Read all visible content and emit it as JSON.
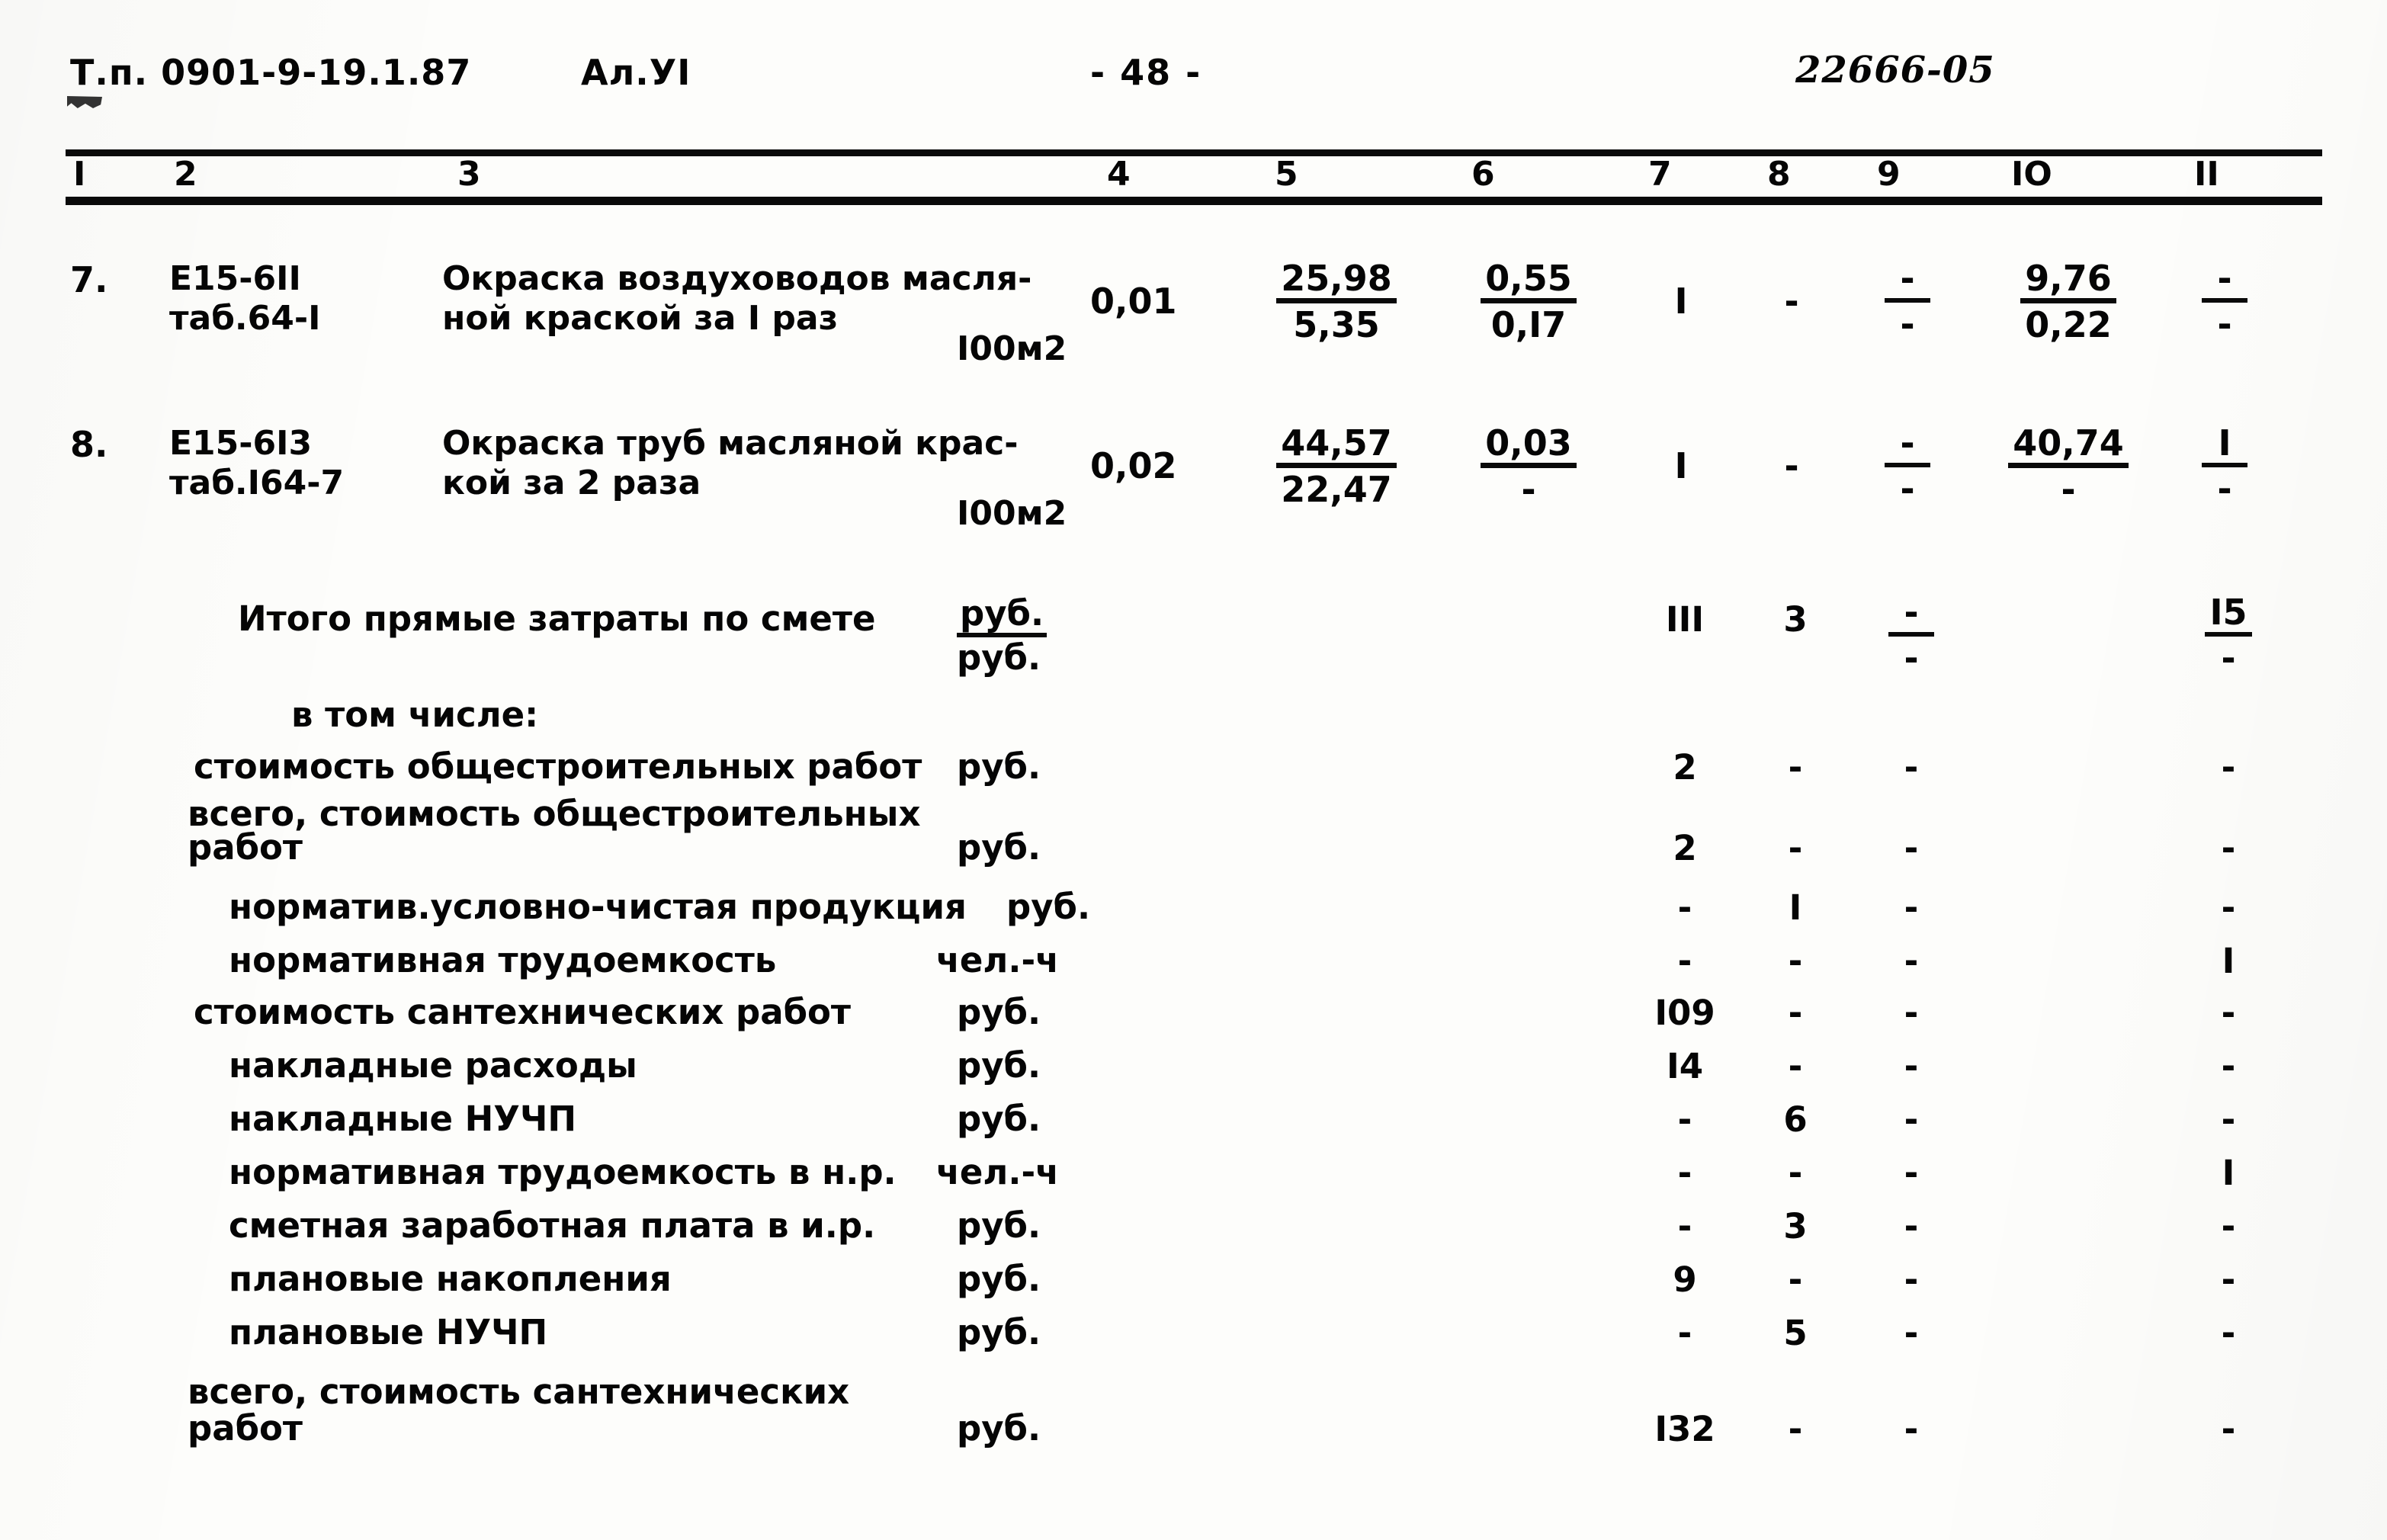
{
  "header": {
    "type_project": "Т.п.  0901-9-19.1.87",
    "album": "Ал.УI",
    "page": "- 48 -",
    "doc_code": "22666-05"
  },
  "column_headers": [
    "I",
    "2",
    "3",
    "4",
    "5",
    "6",
    "7",
    "8",
    "9",
    "IO",
    "II"
  ],
  "rows": [
    {
      "num": "7.",
      "code_line1": "Е15-6II",
      "code_line2": "таб.64-I",
      "desc_line1": "Окраска воздуховодов масля-",
      "desc_line2": "ной краской за I раз",
      "unit": "I00м2",
      "qty": "0,01",
      "c5_top": "25,98",
      "c5_bot": "5,35",
      "c6_top": "0,55",
      "c6_bot": "0,I7",
      "c7": "I",
      "c8": "-",
      "c9_top": "-",
      "c9_bot": "-",
      "c10_top": "9,76",
      "c10_bot": "0,22",
      "c11_top": "-",
      "c11_bot": "-"
    },
    {
      "num": "8.",
      "code_line1": "Е15-6I3",
      "code_line2": "таб.I64-7",
      "desc_line1": "Окраска труб масляной крас-",
      "desc_line2": "кой за 2 раза",
      "unit": "I00м2",
      "qty": "0,02",
      "c5_top": "44,57",
      "c5_bot": "22,47",
      "c6_top": "0,03",
      "c6_bot": "-",
      "c7": "I",
      "c8": "-",
      "c9_top": "-",
      "c9_bot": "-",
      "c10_top": "40,74",
      "c10_bot": "-",
      "c11_top": "I",
      "c11_bot": "-"
    }
  ],
  "totals": {
    "title": "Итого прямые затраты по смете",
    "title_unit_top": "руб.",
    "title_unit_bot": "руб.",
    "title_c7": "III",
    "title_c8": "3",
    "title_c9_top": "-",
    "title_c9_bot": "-",
    "title_c10": "",
    "title_c11_top": "I5",
    "title_c11_bot": "-",
    "subheading": "в том числе:",
    "items": [
      {
        "label": "стоимость общестроительных работ",
        "label2": "",
        "unit": "руб.",
        "c7": "2",
        "c8": "-",
        "c9": "-",
        "c10": "",
        "c11": "-"
      },
      {
        "label": "всего, стоимость общестроительных",
        "label2": "работ",
        "unit": "руб.",
        "c7": "2",
        "c8": "-",
        "c9": "-",
        "c10": "",
        "c11": "-"
      },
      {
        "label": "норматив.условно-чистая продукция",
        "label2": "",
        "unit": "руб.",
        "c7": "-",
        "c8": "I",
        "c9": "-",
        "c10": "",
        "c11": "-"
      },
      {
        "label": "нормативная трудоемкость",
        "label2": "",
        "unit": "чел.-ч",
        "c7": "-",
        "c8": "-",
        "c9": "-",
        "c10": "",
        "c11": "I"
      },
      {
        "label": "стоимость сантехнических работ",
        "label2": "",
        "unit": "руб.",
        "c7": "I09",
        "c8": "-",
        "c9": "-",
        "c10": "",
        "c11": "-"
      },
      {
        "label": "накладные расходы",
        "label2": "",
        "unit": "руб.",
        "c7": "I4",
        "c8": "-",
        "c9": "-",
        "c10": "",
        "c11": "-"
      },
      {
        "label": "накладные НУЧП",
        "label2": "",
        "unit": "руб.",
        "c7": "-",
        "c8": "6",
        "c9": "-",
        "c10": "",
        "c11": "-"
      },
      {
        "label": "нормативная трудоемкость в н.р.",
        "label2": "",
        "unit": "чел.-ч",
        "c7": "-",
        "c8": "-",
        "c9": "-",
        "c10": "",
        "c11": "I"
      },
      {
        "label": "сметная заработная плата в и.р.",
        "label2": "",
        "unit": "руб.",
        "c7": "-",
        "c8": "3",
        "c9": "-",
        "c10": "",
        "c11": "-"
      },
      {
        "label": "плановые накопления",
        "label2": "",
        "unit": "руб.",
        "c7": "9",
        "c8": "-",
        "c9": "-",
        "c10": "",
        "c11": "-"
      },
      {
        "label": "плановые НУЧП",
        "label2": "",
        "unit": "руб.",
        "c7": "-",
        "c8": "5",
        "c9": "-",
        "c10": "",
        "c11": "-"
      },
      {
        "label": "всего, стоимость сантехнических",
        "label2": "работ",
        "unit": "руб.",
        "c7": "I32",
        "c8": "-",
        "c9": "-",
        "c10": "",
        "c11": "-"
      }
    ]
  }
}
